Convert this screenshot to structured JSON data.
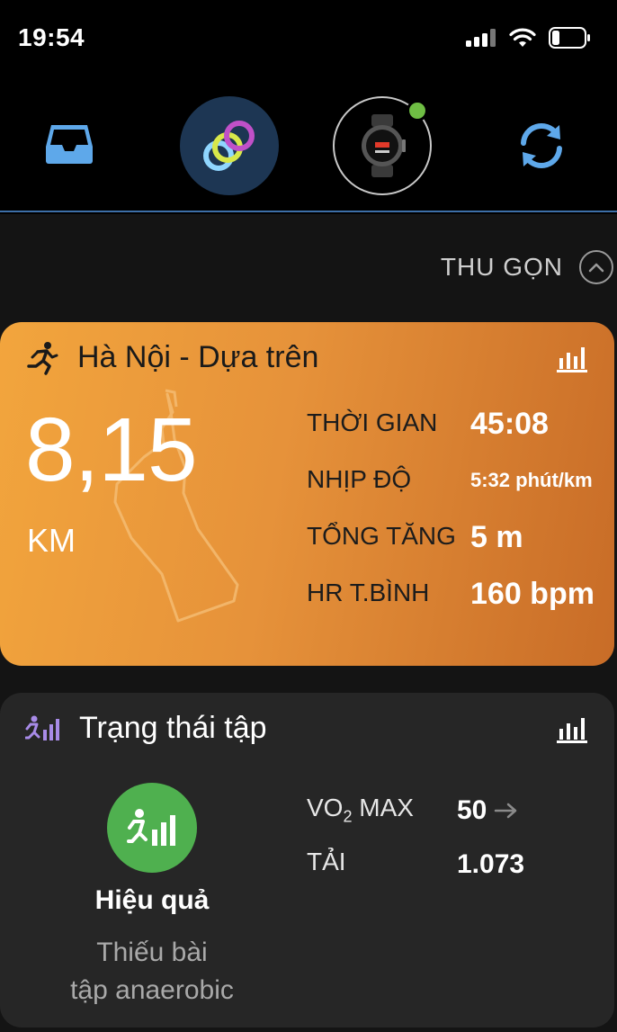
{
  "status_bar": {
    "time": "19:54"
  },
  "nav": {
    "items": [
      {
        "name": "inbox-icon"
      },
      {
        "name": "connect-icon"
      },
      {
        "name": "watch-device-icon"
      },
      {
        "name": "sync-icon"
      }
    ],
    "accent_color": "#3d6fa8",
    "device_status_color": "#6fbe44"
  },
  "collapse": {
    "label": "THU GỌN"
  },
  "activity": {
    "title": "Hà Nội - Dựa trên",
    "distance": "8,15",
    "unit": "KM",
    "stats": [
      {
        "label": "THỜI GIAN",
        "value": "45:08"
      },
      {
        "label": "NHỊP ĐỘ",
        "value": "5:32 phút/km"
      },
      {
        "label": "TỔNG TĂNG",
        "value": "5 m"
      },
      {
        "label": "HR T.BÌNH",
        "value": "160 bpm"
      }
    ],
    "card_gradient": [
      "#f2a53d",
      "#c86c27"
    ]
  },
  "training": {
    "title": "Trạng thái tập",
    "status_name": "Hiệu quả",
    "status_desc_line1": "Thiếu bài",
    "status_desc_line2": "tập anaerobic",
    "status_color": "#4fb04f",
    "vo2_label_main": "VO",
    "vo2_label_sub": "2",
    "vo2_label_rest": " MAX",
    "vo2_value": "50",
    "load_label": "TẢI",
    "load_value": "1.073"
  }
}
